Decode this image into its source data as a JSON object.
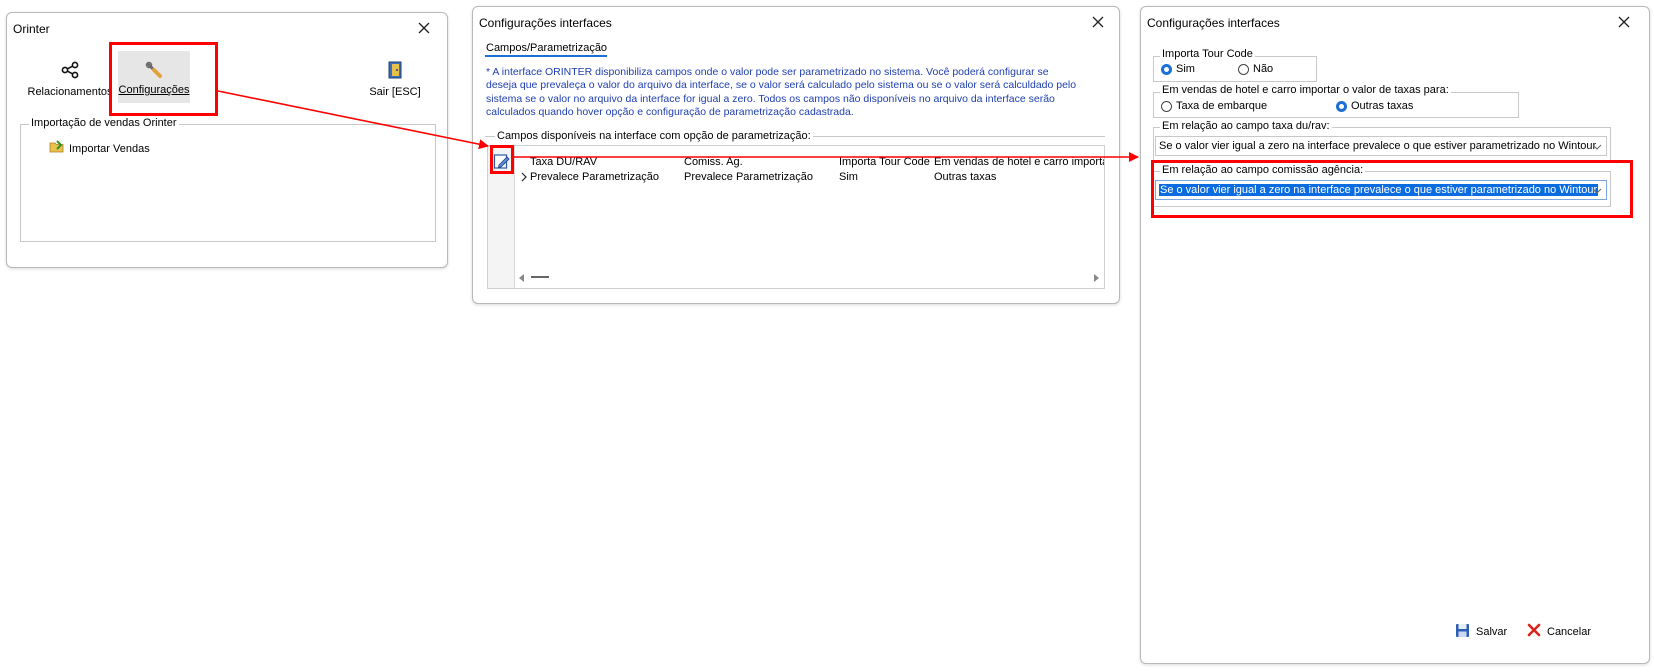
{
  "orinter_window": {
    "title": "Orinter",
    "toolbar": {
      "relacionamentos": "Relacionamentos",
      "configuracoes": "Configurações",
      "sair": "Sair [ESC]"
    },
    "group_title": "Importação de vendas Orinter",
    "importar_vendas": "Importar Vendas"
  },
  "config_window_1": {
    "title": "Configurações interfaces",
    "tab": "Campos/Parametrização",
    "info_lines": [
      "* A interface ORINTER disponibiliza campos onde o valor pode ser parametrizado no sistema. Você poderá configurar se",
      "deseja que prevaleça o valor do arquivo da interface, se o valor será calculado pelo sistema ou se o valor será calculdado pelo",
      "sistema se o valor no arquivo da interface for igual a zero. Todos os campos não disponíveis no arquivo da interface serão",
      "calculados quando hover opção e configuração de parametrização cadastrada."
    ],
    "grid_group_title": "Campos disponíveis na interface com opção de parametrização:",
    "grid": {
      "headers": [
        "Taxa DU/RAV",
        "Comiss. Ag.",
        "Importa Tour Code",
        "Em vendas de hotel e carro importa"
      ],
      "row": [
        "Prevalece Parametrização",
        "Prevalece Parametrização",
        "Sim",
        "Outras taxas"
      ]
    }
  },
  "config_window_2": {
    "title": "Configurações interfaces",
    "tour_code": {
      "legend": "Importa Tour Code",
      "options": [
        "Sim",
        "Não"
      ],
      "selected": "Sim"
    },
    "hotel_carro": {
      "legend": "Em vendas de hotel e carro importar o valor de taxas para:",
      "options": [
        "Taxa de embarque",
        "Outras taxas"
      ],
      "selected": "Outras taxas"
    },
    "taxa_du_rav": {
      "legend": "Em relação ao campo taxa du/rav:",
      "value": "Se o valor vier igual a zero na interface prevalece o que estiver parametrizado no Wintour"
    },
    "comissao_agencia": {
      "legend": "Em relação ao campo comissão agência:",
      "value": "Se o valor vier igual a zero na interface prevalece o que estiver parametrizado no Wintour"
    },
    "salvar": "Salvar",
    "cancelar": "Cancelar"
  },
  "colors": {
    "highlight": "#ff0000",
    "accent": "#1c6fd6",
    "info_text": "#1f3fb0",
    "selection": "#0b6ce0"
  }
}
